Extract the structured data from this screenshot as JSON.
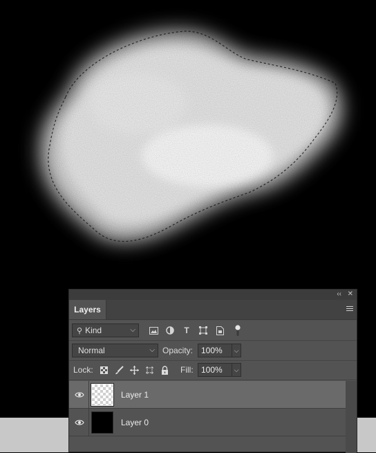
{
  "canvas": {
    "background": "#000000",
    "pasteboard_color": "#c8c8c8"
  },
  "panel": {
    "topbar": {
      "collapse_icon": "double-chevron-right-icon",
      "close_icon": "close-icon",
      "collapse_glyph": "‹‹",
      "close_glyph": "✕"
    },
    "tab_label": "Layers",
    "filter": {
      "kind_label": "Kind",
      "icons": [
        "pixel-filter-icon",
        "adjustment-filter-icon",
        "type-filter-icon",
        "shape-filter-icon",
        "smart-object-filter-icon",
        "filter-toggle-icon"
      ],
      "type_glyph": "T"
    },
    "blend": {
      "mode": "Normal",
      "opacity_label": "Opacity:",
      "opacity_value": "100%"
    },
    "lock": {
      "label": "Lock:",
      "icons": [
        "lock-transparent-pixels-icon",
        "lock-image-pixels-icon",
        "lock-position-icon",
        "prevent-auto-nesting-icon",
        "lock-all-icon"
      ],
      "fill_label": "Fill:",
      "fill_value": "100%"
    },
    "layers": [
      {
        "name": "Layer 1",
        "selected": true,
        "visible": true,
        "thumbnail": "transparent"
      },
      {
        "name": "Layer 0",
        "selected": false,
        "visible": true,
        "thumbnail": "black"
      }
    ]
  }
}
